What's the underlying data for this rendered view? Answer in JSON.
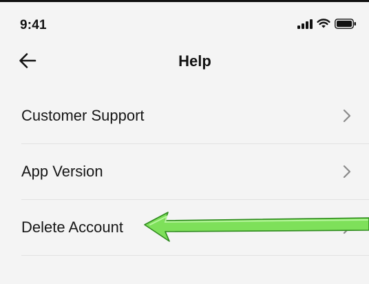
{
  "status_bar": {
    "time": "9:41",
    "icons": [
      "cellular-signal-icon",
      "wifi-icon",
      "battery-icon"
    ]
  },
  "nav": {
    "title": "Help",
    "back_icon": "arrow-left-icon"
  },
  "menu": {
    "items": [
      {
        "label": "Customer Support",
        "icon": "chevron-right-icon"
      },
      {
        "label": "App Version",
        "icon": "chevron-right-icon"
      },
      {
        "label": "Delete Account",
        "icon": "chevron-right-icon"
      }
    ]
  },
  "annotation": {
    "type": "arrow",
    "color": "#7ee05a",
    "outline_color": "#2f8a1f",
    "points_to": "Delete Account"
  },
  "colors": {
    "background": "#f4f4f4",
    "text": "#111111",
    "divider": "#e2e2e2",
    "chevron": "#8a8a8a"
  }
}
